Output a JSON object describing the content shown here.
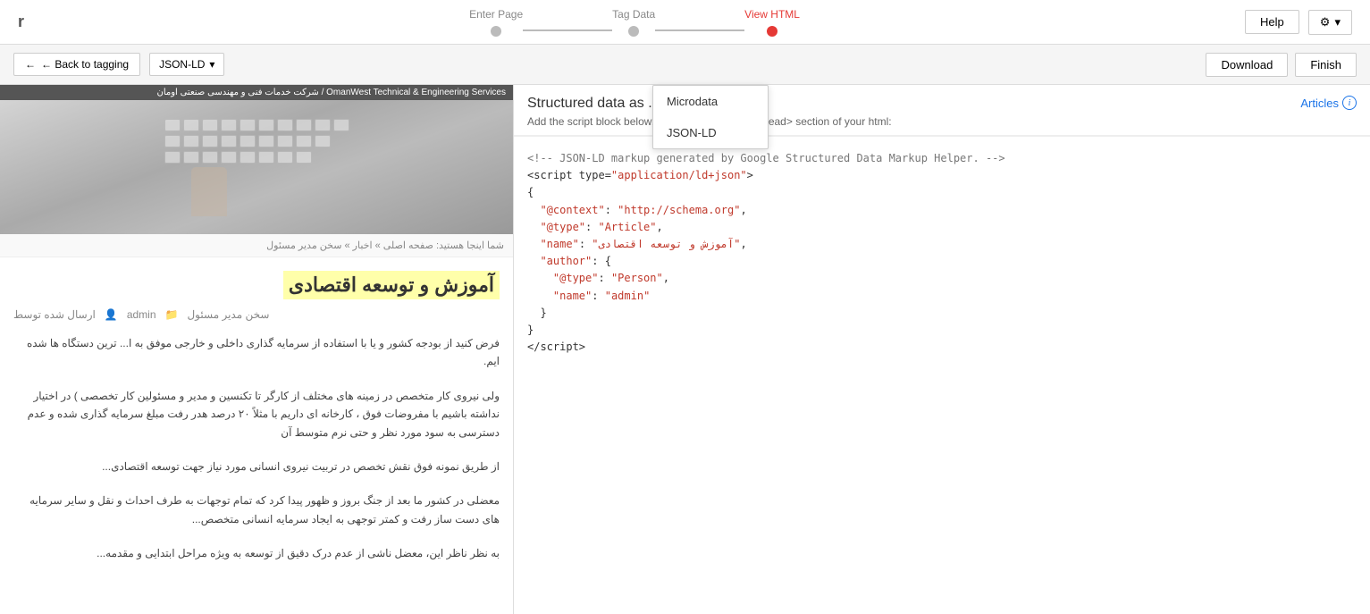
{
  "topNav": {
    "leftLabel": "r",
    "steps": [
      {
        "label": "Enter Page",
        "active": false
      },
      {
        "label": "Tag Data",
        "active": false
      },
      {
        "label": "View HTML",
        "active": true
      }
    ],
    "helpButton": "Help",
    "settingsButton": "⚙",
    "settingsArrow": "▾"
  },
  "secondBar": {
    "backButton": "← Back to tagging",
    "dropdownLabel": "JSON-LD",
    "dropdownArrow": "▾",
    "downloadButton": "Download",
    "finishButton": "Finish"
  },
  "dropdown": {
    "visible": true,
    "items": [
      "Microdata",
      "JSON-LD"
    ]
  },
  "rightPanel": {
    "title": "Structured data as",
    "titleSuffix": "...",
    "addScriptText": "Add the script block below, or paste it inside the <head> section of your html:",
    "articlesLink": "Articles",
    "codeContent": "<!-- JSON-LD markup generated by Google Structured Data Markup Helper. -->\n<script type=\"application/ld+json\">\n{\n  \"@context\": \"http://schema.org\",\n  \"@type\": \"Article\",\n  \"name\": \"آموزش و توسعه اقتصادی\",\n  \"author\": {\n    \"@type\": \"Person\",\n    \"name\": \"admin\"\n  }\n}\n</script>"
  },
  "leftPanel": {
    "headerText": "OmanWest Technical & Engineering Services / شرکت خدمات فنی و مهندسی صنعتی اومان",
    "breadcrumb": "شما اینجا هستید: صفحه اصلی » اخبار » سخن مدیر مسئول",
    "articleTitle": "آموزش و توسعه اقتصادی",
    "metaAuthor": "admin",
    "metaCategory": "سخن مدیر مسئول",
    "paragraphs": [
      "فرض کنید از بودجه کشور و یا با استفاده از سرمایه گذاری داخلی و خارجی موفق به ا... ترین دستگاه ها شده ایم.",
      "ولی نیروی کار متخصص در زمینه های مختلف از کارگر تا تکنسین و مدیر و مسئولین کار تخصصی ) در اختیار نداشته باشیم با مفروضات فوق ، کارخانه ای داریم با مثلاً ۲۰ درصد هدر رفت مبلغ سرمایه گذاری شده و عدم دسترسی به سود مورد نظر و حتی نرم متوسط آن",
      "از طریق نمونه فوق نقش تخصص در تربیت نیروی انسانی مورد نیاز جهت توسعه اقتصادی...",
      "معضلی در کشور ما بعد از جنگ بروز و ظهور پیدا کرد که تمام توجهات به طرف احداث و نقل و سایر سرمایه های دست ساز رفت و کمتر توجهی به ایجاد سرمایه انسانی متخصص...",
      "به نظر ناظر این، معضل ناشی از عدم درک دقیق از توسعه به ویژه مراحل ابتدایی و مقدمه..."
    ]
  }
}
